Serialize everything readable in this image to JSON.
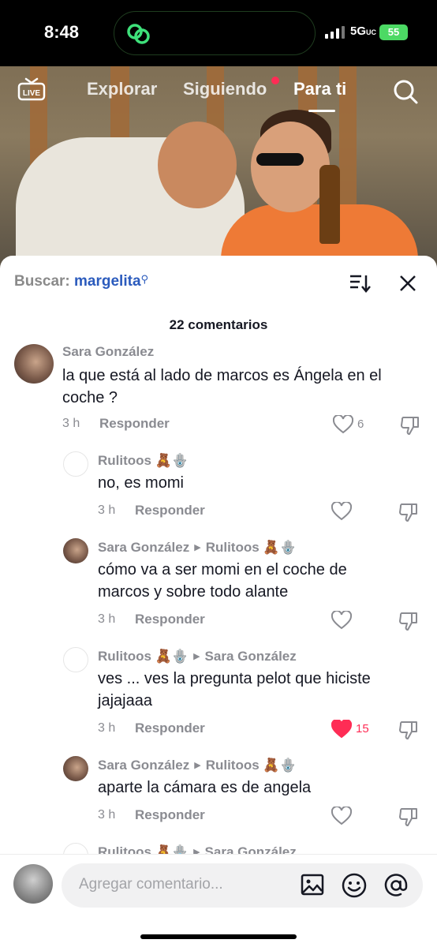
{
  "status_bar": {
    "time": "8:48",
    "network": "5G",
    "network_suffix": "UC",
    "battery": "55"
  },
  "top_nav": {
    "live_label": "LIVE",
    "tabs": [
      {
        "label": "Explorar"
      },
      {
        "label": "Siguiendo"
      },
      {
        "label": "Para ti"
      }
    ]
  },
  "comments_sheet": {
    "search_prefix": "Buscar:",
    "search_term": "margelita",
    "count_label": "22 comentarios",
    "comments": [
      {
        "user": "Sara González",
        "to": "",
        "text_lines": [
          "la que está al lado de marcos es Ángela en el",
          "coche ?"
        ],
        "time": "3 h",
        "reply": "Responder",
        "likes": "6",
        "liked": false
      },
      {
        "user": "Rulitoos",
        "emoji": "🧸🪬",
        "to": "",
        "text_lines": [
          "no, es momi"
        ],
        "time": "3 h",
        "reply": "Responder",
        "likes": "",
        "liked": false
      },
      {
        "user": "Sara González",
        "to": "Rulitoos",
        "to_emoji": "🧸🪬",
        "text_lines": [
          "cómo va a ser momi en el coche de",
          "marcos y sobre todo alante"
        ],
        "time": "3 h",
        "reply": "Responder",
        "likes": "",
        "liked": false
      },
      {
        "user": "Rulitoos",
        "emoji": "🧸🪬",
        "to": "Sara González",
        "text_lines": [
          "ves ... ves la pregunta pelot que hiciste",
          "jajajaaa"
        ],
        "time": "3 h",
        "reply": "Responder",
        "likes": "15",
        "liked": true
      },
      {
        "user": "Sara González",
        "to": "Rulitoos",
        "to_emoji": "🧸🪬",
        "text_lines": [
          "aparte la cámara es de angela"
        ],
        "time": "3 h",
        "reply": "Responder",
        "likes": "",
        "liked": false
      },
      {
        "user": "Rulitoos",
        "emoji": "🧸🪬",
        "to": "Sara González"
      }
    ]
  },
  "composer": {
    "placeholder": "Agregar comentario..."
  },
  "colors": {
    "accent": "#fe2c55",
    "link": "#2b5bbd",
    "muted": "#8a8b91",
    "battery": "#4cd964"
  }
}
